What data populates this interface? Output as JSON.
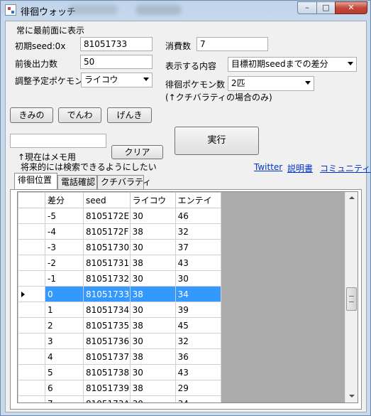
{
  "window": {
    "title": "徘徊ウォッチ",
    "min_glyph": "–",
    "max_glyph": "□",
    "close_glyph": "✕"
  },
  "form": {
    "always_on_top_label": "常に最前面に表示",
    "initial_seed_label": "初期seed:0x",
    "initial_seed_value": "81051733",
    "consumption_label": "消費数",
    "consumption_value": "7",
    "output_count_label": "前後出力数",
    "output_count_value": "50",
    "display_content_label": "表示する内容",
    "display_content_value": "目標初期seedまでの差分",
    "adjust_pokemon_label": "調整予定ポケモン",
    "adjust_pokemon_value": "ライコウ",
    "roamer_count_label": "徘徊ポケモン数",
    "roamer_count_value": "2匹",
    "roamer_note": "(↑クチバラティの場合のみ)",
    "button_kimino": "きみの",
    "button_denwa": "でんわ",
    "button_genki": "げんき",
    "memo_value": "",
    "memo_note_1": "↑現在はメモ用",
    "memo_note_2": "将来的には検索できるようにしたい",
    "button_clear": "クリア",
    "button_run": "実行",
    "link_twitter": "Twitter",
    "link_manual": "説明書",
    "link_community": "コミュニティ"
  },
  "tabs": [
    {
      "label": "徘徊位置"
    },
    {
      "label": "電話確認"
    },
    {
      "label": "クチバラティ"
    }
  ],
  "grid": {
    "columns": [
      "差分",
      "seed",
      "ライコウ",
      "エンテイ"
    ],
    "rows": [
      [
        "-5",
        "8105172E",
        "30",
        "46"
      ],
      [
        "-4",
        "8105172F",
        "38",
        "32"
      ],
      [
        "-3",
        "81051730",
        "30",
        "37"
      ],
      [
        "-2",
        "81051731",
        "38",
        "43"
      ],
      [
        "-1",
        "81051732",
        "30",
        "30"
      ],
      [
        "0",
        "81051733",
        "38",
        "34"
      ],
      [
        "1",
        "81051734",
        "30",
        "39"
      ],
      [
        "2",
        "81051735",
        "38",
        "45"
      ],
      [
        "3",
        "81051736",
        "30",
        "32"
      ],
      [
        "4",
        "81051737",
        "38",
        "36"
      ],
      [
        "5",
        "81051738",
        "30",
        "43"
      ],
      [
        "6",
        "81051739",
        "38",
        "29"
      ],
      [
        "7",
        "8105173A",
        "30",
        "34"
      ]
    ],
    "selected_row": 5,
    "selection_color": "#3399ff"
  }
}
